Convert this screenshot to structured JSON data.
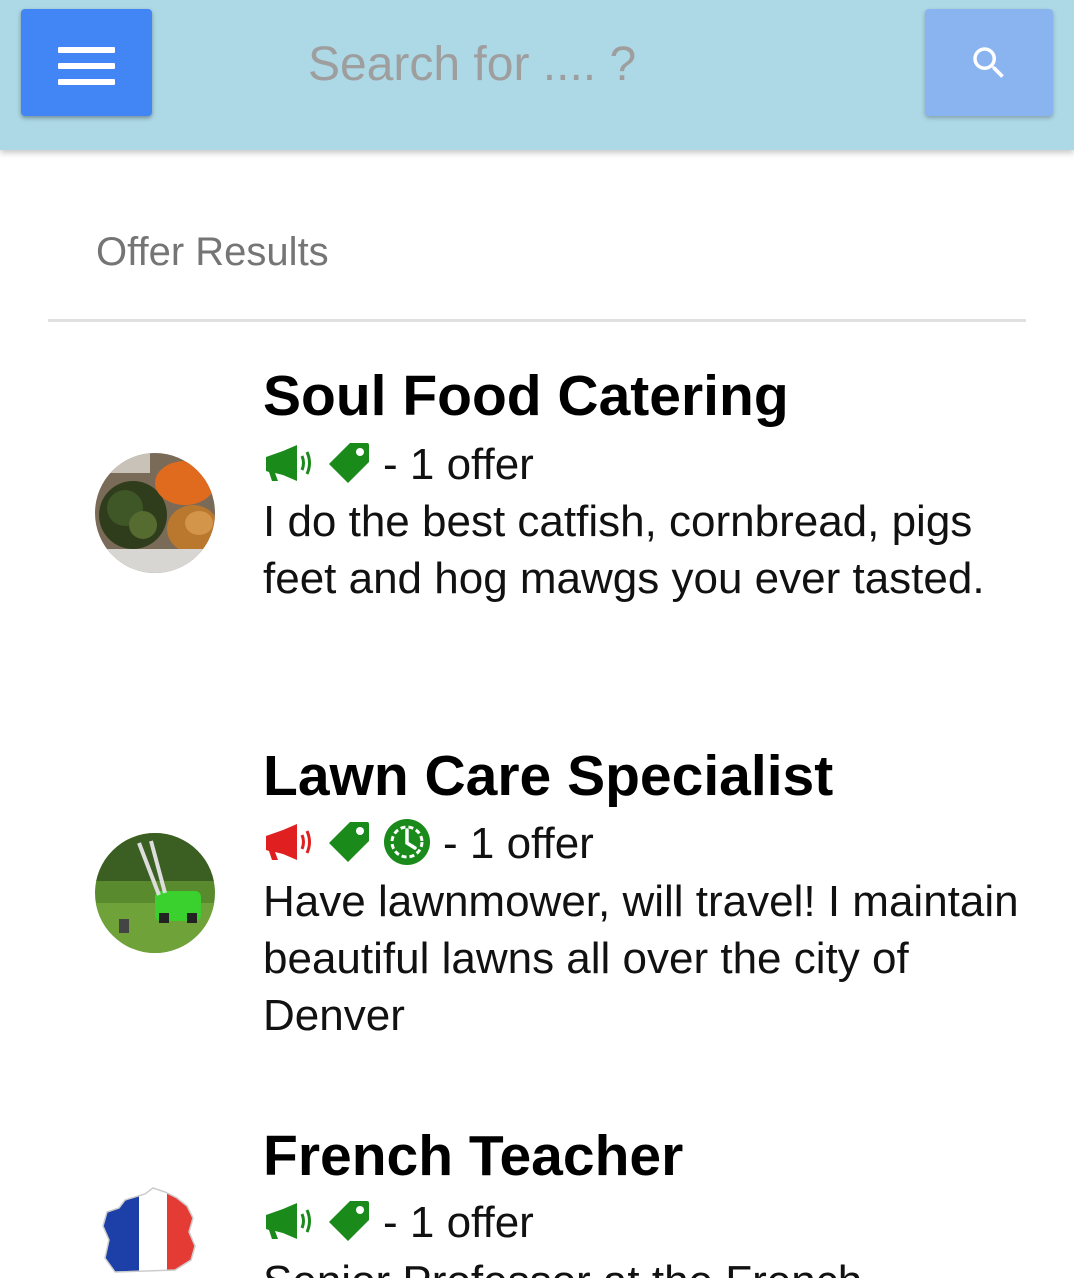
{
  "header": {
    "search_placeholder": "Search for .... ?"
  },
  "section": {
    "title": "Offer Results"
  },
  "offers": [
    {
      "title": "Soul Food Catering",
      "count_text": "- 1 offer",
      "description": "I do the best catfish, cornbread, pigs feet and hog mawgs you ever tasted.",
      "icons": [
        "megaphone-icon",
        "tag-icon"
      ],
      "megaphone_color": "#1a8a1a"
    },
    {
      "title": "Lawn Care Specialist",
      "count_text": "- 1 offer",
      "description": "Have lawnmower, will travel! I maintain beautiful lawns all over the city of Denver",
      "icons": [
        "megaphone-icon",
        "tag-icon",
        "clock-icon"
      ],
      "megaphone_color": "#e02020"
    },
    {
      "title": "French Teacher",
      "count_text": "- 1 offer",
      "description": "Senior Professor at the French",
      "icons": [
        "megaphone-icon",
        "tag-icon"
      ],
      "megaphone_color": "#1a8a1a"
    }
  ],
  "colors": {
    "topbar": "#add8e6",
    "menu_button": "#4285f4",
    "search_button": "#8ab4f0",
    "tag_green": "#1a8a1a"
  }
}
